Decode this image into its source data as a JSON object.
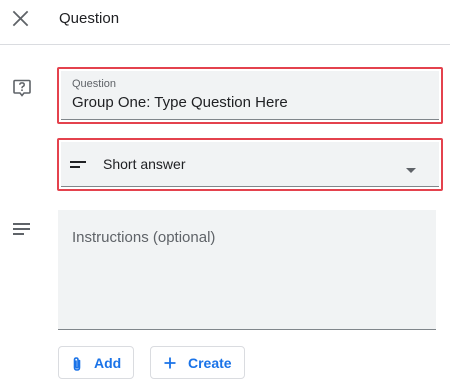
{
  "header": {
    "title": "Question",
    "close_icon": "close-icon"
  },
  "question": {
    "icon": "question-box-icon",
    "label": "Question",
    "value": "Group One: Type Question Here"
  },
  "answer_type": {
    "icon": "short-answer-icon",
    "selected": "Short answer",
    "dropdown_icon": "dropdown-arrow-icon"
  },
  "instructions": {
    "icon": "notes-lines-icon",
    "placeholder": "Instructions (optional)"
  },
  "actions": {
    "add_label": "Add",
    "add_icon": "paperclip-icon",
    "create_label": "Create",
    "create_icon": "plus-icon"
  },
  "colors": {
    "highlight": "#e4424d",
    "accent": "#1a73e8",
    "field_background": "#f1f3f4"
  }
}
